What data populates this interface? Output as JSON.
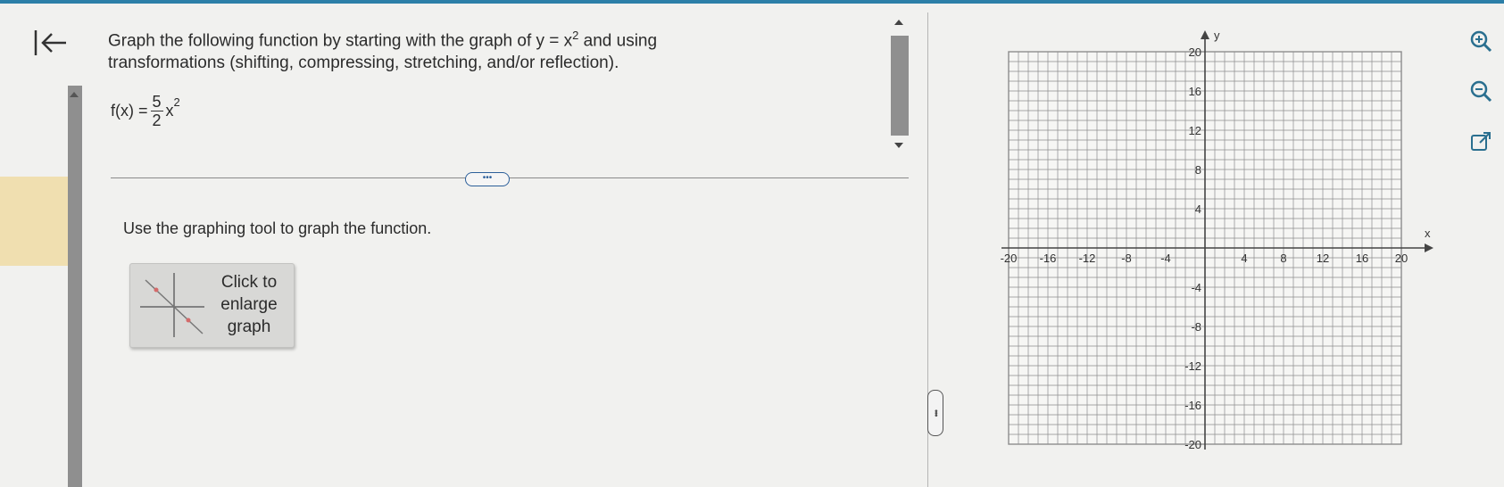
{
  "header": {
    "accent_color": "#2c7fa8"
  },
  "navigation": {
    "back_icon": "back-to-start-icon"
  },
  "question": {
    "prompt_line1": "Graph the following function by starting with the graph of y = x",
    "prompt_exp": "2",
    "prompt_line1_end": " and using",
    "prompt_line2": "transformations (shifting, compressing, stretching, and/or reflection).",
    "function": {
      "lhs": "f(x) =",
      "numerator": "5",
      "denominator": "2",
      "var": "x",
      "exp": "2"
    },
    "more_button": "•••",
    "instruction": "Use the graphing tool to graph the function."
  },
  "enlarge": {
    "label_line1": "Click to",
    "label_line2": "enlarge",
    "label_line3": "graph"
  },
  "graph": {
    "x_label": "x",
    "y_label": "y",
    "x_ticks": [
      "-20",
      "-16",
      "-12",
      "-8",
      "-4",
      "4",
      "8",
      "12",
      "16",
      "20"
    ],
    "y_ticks": [
      "20",
      "16",
      "12",
      "8",
      "4",
      "-4",
      "-8",
      "-12",
      "-16",
      "-20"
    ],
    "range": {
      "xmin": -20,
      "xmax": 20,
      "ymin": -20,
      "ymax": 20,
      "grid_step": 1
    }
  },
  "tools": {
    "zoom_in_icon": "zoom-in-icon",
    "zoom_out_icon": "zoom-out-icon",
    "popout_icon": "external-link-icon"
  },
  "colors": {
    "link": "#2c5f9a",
    "tool_icon": "#2a6f8f",
    "grid": "#8c8c8c"
  }
}
